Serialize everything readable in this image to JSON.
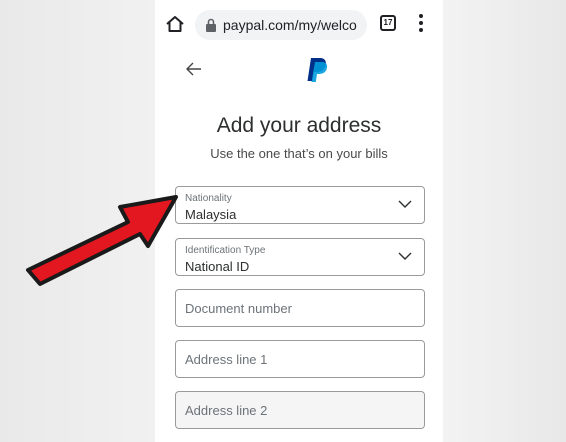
{
  "browser": {
    "url": "paypal.com/my/welco",
    "tab_count": "17"
  },
  "page": {
    "title": "Add your address",
    "subtitle": "Use the one that’s on your bills"
  },
  "form": {
    "nationality": {
      "label": "Nationality",
      "value": "Malaysia"
    },
    "id_type": {
      "label": "Identification Type",
      "value": "National ID"
    },
    "document_number": {
      "placeholder": "Document number"
    },
    "address_line_1": {
      "placeholder": "Address line 1"
    },
    "address_line_2": {
      "placeholder": "Address line 2"
    }
  },
  "colors": {
    "paypal_dark_blue": "#003087",
    "paypal_light_blue": "#009cde",
    "arrow_red": "#e3171f"
  }
}
